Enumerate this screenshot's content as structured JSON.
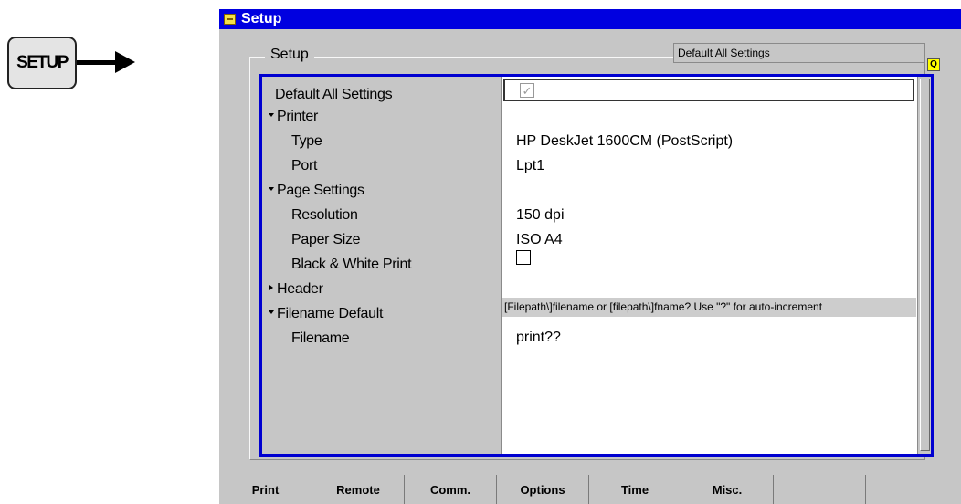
{
  "setup_key": {
    "label": "SETUP"
  },
  "window": {
    "title": "Setup"
  },
  "group": {
    "caption": "Setup",
    "default_box": "Default All Settings"
  },
  "rows": [
    {
      "label": "Default All Settings",
      "value": ""
    },
    {
      "label": "Printer",
      "value": ""
    },
    {
      "label": "Type",
      "value": "HP DeskJet 1600CM (PostScript)"
    },
    {
      "label": "Port",
      "value": "Lpt1"
    },
    {
      "label": "Page Settings",
      "value": ""
    },
    {
      "label": "Resolution",
      "value": "150 dpi"
    },
    {
      "label": "Paper Size",
      "value": "ISO A4"
    },
    {
      "label": "Black & White Print",
      "value": ""
    },
    {
      "label": "Header",
      "value": ""
    },
    {
      "label": "Filename Default",
      "value": ""
    },
    {
      "label": "Filename",
      "value": "print??"
    }
  ],
  "hint": "[Filepath\\]filename or [filepath\\]fname? Use \"?\" for auto-increment",
  "default_all_checked": true,
  "bw_print_checked": false,
  "tabs": [
    {
      "label": "Print"
    },
    {
      "label": "Remote"
    },
    {
      "label": "Comm."
    },
    {
      "label": "Options"
    },
    {
      "label": "Time"
    },
    {
      "label": "Misc."
    },
    {
      "label": ""
    },
    {
      "label": ""
    }
  ],
  "colors": {
    "title_bar": "#0000e0",
    "panel_border": "#0000d0",
    "background": "#c6c6c6"
  }
}
